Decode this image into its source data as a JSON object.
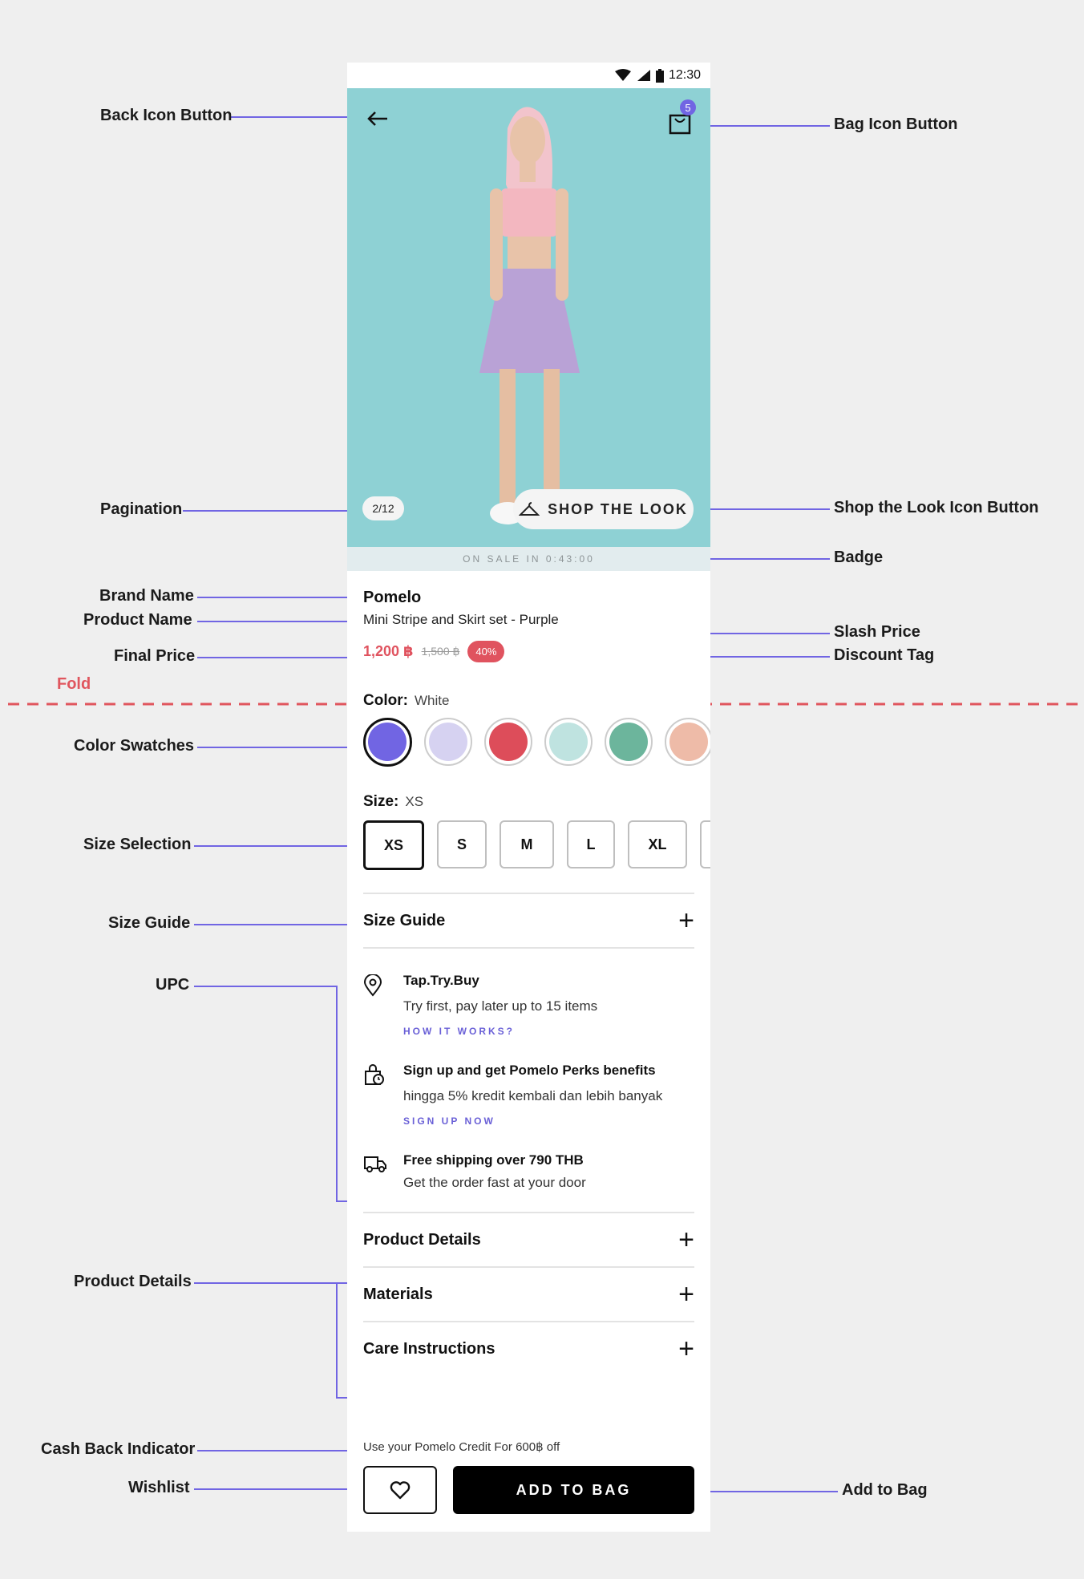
{
  "colors": {
    "accent": "#7165e3",
    "sale": "#e0535f",
    "hero_bg": "#8ed1d4"
  },
  "status_bar": {
    "time": "12:30"
  },
  "annotations": {
    "back_icon_button": "Back Icon Button",
    "bag_icon_button": "Bag Icon Button",
    "pagination": "Pagination",
    "shop_the_look_icon_button": "Shop the Look Icon Button",
    "badge": "Badge",
    "brand_name": "Brand Name",
    "product_name": "Product Name",
    "slash_price": "Slash Price",
    "final_price": "Final Price",
    "discount_tag": "Discount Tag",
    "fold": "Fold",
    "color_swatches": "Color Swatches",
    "size_selection": "Size Selection",
    "size_guide": "Size Guide",
    "upc": "UPC",
    "product_details": "Product Details",
    "cash_back_indicator": "Cash Back Indicator",
    "wishlist": "Wishlist",
    "add_to_bag": "Add to Bag"
  },
  "header": {
    "back_icon": "arrow-left-icon",
    "bag_icon": "shopping-bag-icon",
    "bag_count": "5"
  },
  "hero": {
    "pagination": "2/12",
    "shop_the_look": "SHOP THE LOOK"
  },
  "badge": {
    "text": "ON SALE IN 0:43:00"
  },
  "product": {
    "brand": "Pomelo",
    "name": "Mini Stripe and Skirt set - Purple",
    "final_price": "1,200 ฿",
    "slash_price": "1,500 ฿",
    "discount": "40%"
  },
  "color": {
    "label": "Color:",
    "value": "White",
    "swatches": [
      "#7165e3",
      "#d6d2f1",
      "#dd4d5a",
      "#bfe3e0",
      "#6cb59c",
      "#eebba8"
    ]
  },
  "size": {
    "label": "Size:",
    "value": "XS",
    "options": [
      "XS",
      "S",
      "M",
      "L",
      "XL",
      ""
    ]
  },
  "size_guide": {
    "label": "Size Guide"
  },
  "upc": [
    {
      "icon": "location-pin-icon",
      "title": "Tap.Try.Buy",
      "subtitle": "Try first, pay later up to 15 items",
      "link": "HOW IT WORKS?"
    },
    {
      "icon": "shopping-bag-clock-icon",
      "title": "Sign up and get Pomelo Perks benefits",
      "subtitle": "hingga 5% kredit kembali dan lebih banyak",
      "link": "SIGN UP NOW"
    },
    {
      "icon": "delivery-truck-icon",
      "title": "Free shipping over 790 THB",
      "subtitle": "Get the order fast at your door",
      "link": ""
    }
  ],
  "accordions": {
    "product_details": "Product Details",
    "materials": "Materials",
    "care": "Care Instructions"
  },
  "cashback": {
    "text": "Use your Pomelo Credit For 600฿ off"
  },
  "actions": {
    "add_to_bag": "ADD TO BAG"
  }
}
